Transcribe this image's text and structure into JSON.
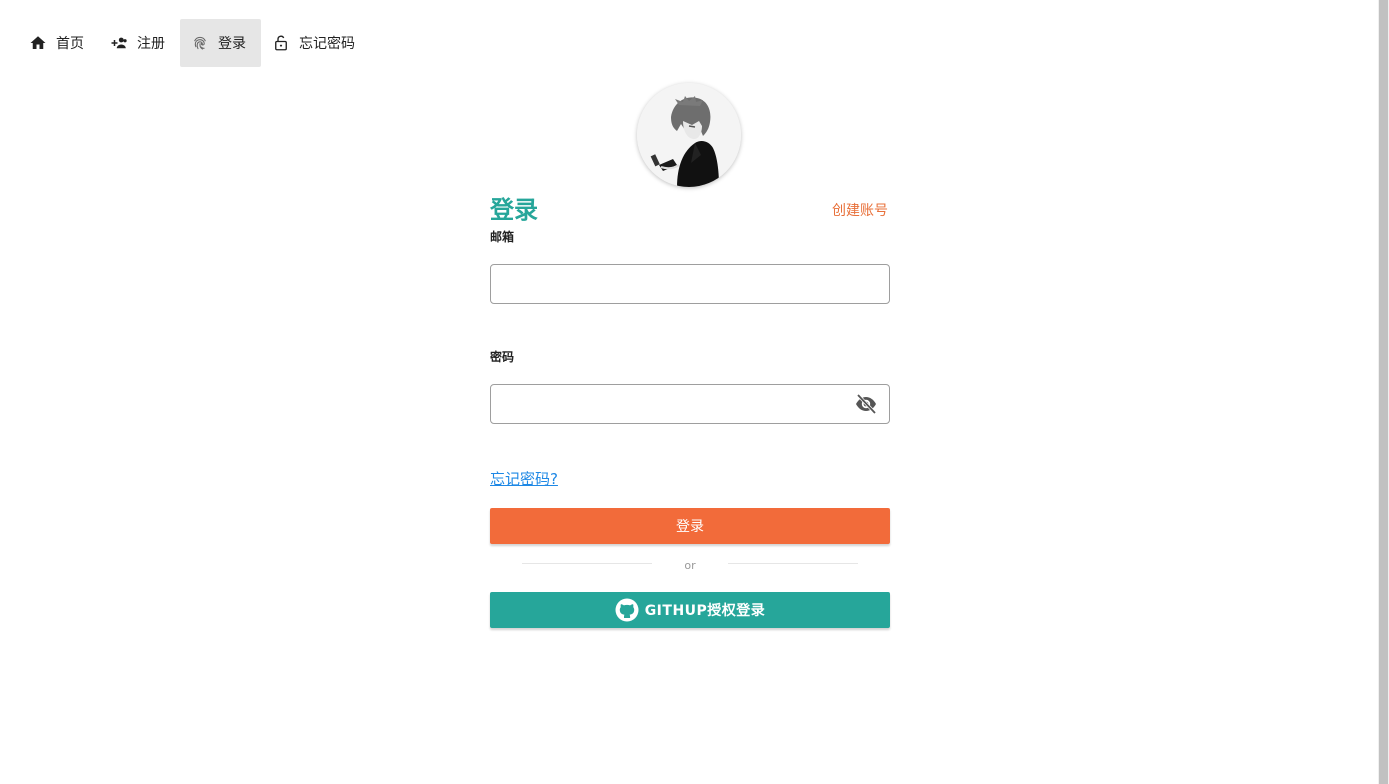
{
  "nav": {
    "items": [
      {
        "label": "首页",
        "icon": "home-icon",
        "active": false
      },
      {
        "label": "注册",
        "icon": "add-user-icon",
        "active": false
      },
      {
        "label": "登录",
        "icon": "fingerprint-icon",
        "active": true
      },
      {
        "label": "忘记密码",
        "icon": "lock-icon",
        "active": false
      }
    ]
  },
  "login": {
    "title": "登录",
    "create_account": "创建账号",
    "email_label": "邮箱",
    "email_value": "",
    "password_label": "密码",
    "password_value": "",
    "forgot_link": "忘记密码?",
    "submit_label": "登录",
    "divider_text": "or",
    "github_label": "GITHUP授权登录"
  },
  "colors": {
    "accent_teal": "#26a69a",
    "accent_orange": "#f26b3a",
    "link_blue": "#1e88e5",
    "active_nav_bg": "#e6e6e6"
  }
}
